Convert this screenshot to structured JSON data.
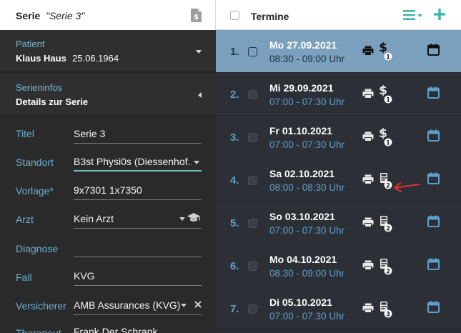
{
  "left": {
    "header": {
      "label": "Serie",
      "value": "\"Serie 3\"",
      "icon": "dollar-document-icon"
    },
    "patient": {
      "label": "Patient",
      "name": "Klaus Haus",
      "birthdate": "25.06.1964"
    },
    "serieninfos": {
      "label": "Serieninfos",
      "value": "Details zur Serie"
    },
    "form": {
      "titel": {
        "label": "Titel",
        "value": "Serie 3"
      },
      "standort": {
        "label": "Standort",
        "value": "B3st Physi0s (Diessenhof..."
      },
      "vorlage": {
        "label": "Vorlage*",
        "value": "9x7301 1x7350"
      },
      "arzt": {
        "label": "Arzt",
        "value": "Kein Arzt"
      },
      "diagnose": {
        "label": "Diagnose",
        "value": ""
      },
      "fall": {
        "label": "Fall",
        "value": "KVG"
      },
      "versicherer": {
        "label": "Versicherer",
        "value": "AMB Assurances (KVG)"
      },
      "therapeut": {
        "label": "Therapeut",
        "value": "Frank Der Schrank"
      }
    }
  },
  "right": {
    "header": {
      "title": "Termine",
      "menu_icon": "list-menu-icon",
      "add_icon": "plus-icon"
    },
    "colors": {
      "accent": "#3fb6a8",
      "selected_row": "#7aa0bd",
      "number_blue": "#5f9ec9"
    },
    "appointments": [
      {
        "num": "1.",
        "date": "Mo 27.09.2021",
        "time": "08:30 - 09:00 Uhr",
        "bill_icon": "dollar-icon",
        "badge": "1",
        "selected": true
      },
      {
        "num": "2.",
        "date": "Mi 29.09.2021",
        "time": "07:00 - 07:30 Uhr",
        "bill_icon": "dollar-icon",
        "badge": "1",
        "selected": false
      },
      {
        "num": "3.",
        "date": "Fr 01.10.2021",
        "time": "07:00 - 07:30 Uhr",
        "bill_icon": "dollar-icon",
        "badge": "1",
        "selected": false
      },
      {
        "num": "4.",
        "date": "Sa 02.10.2021",
        "time": "08:00 - 08:30 Uhr",
        "bill_icon": "calculator-icon",
        "badge": "2",
        "selected": false
      },
      {
        "num": "5.",
        "date": "So 03.10.2021",
        "time": "07:00 - 07:30 Uhr",
        "bill_icon": "calculator-icon",
        "badge": "2",
        "selected": false
      },
      {
        "num": "6.",
        "date": "Mo 04.10.2021",
        "time": "08:30 - 09:00 Uhr",
        "bill_icon": "calculator-icon",
        "badge": "2",
        "selected": false
      },
      {
        "num": "7.",
        "date": "Di 05.10.2021",
        "time": "07:00 - 07:30 Uhr",
        "bill_icon": "calculator-icon",
        "badge": "3",
        "selected": false
      }
    ]
  }
}
